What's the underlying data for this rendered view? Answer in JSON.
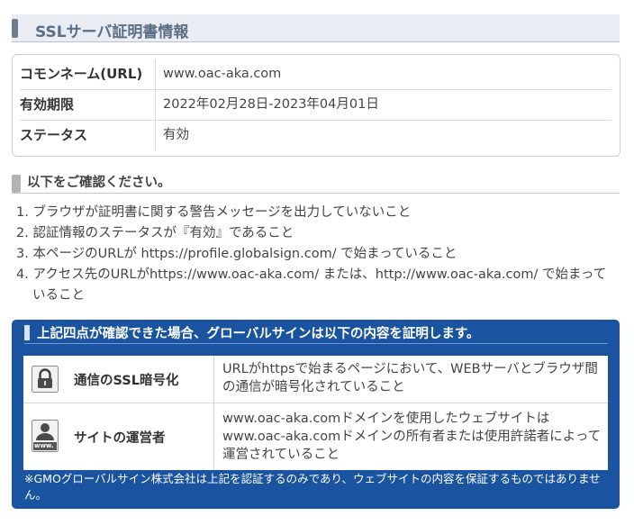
{
  "section_title": "SSLサーバ証明書情報",
  "cert_info": [
    {
      "label": "コモンネーム(URL)",
      "value": "www.oac-aka.com"
    },
    {
      "label": "有効期限",
      "value": "2022年02月28日-2023年04月01日"
    },
    {
      "label": "ステータス",
      "value": "有効"
    }
  ],
  "check_title": "以下をご確認ください。",
  "checks": [
    "1. ブラウザが証明書に関する警告メッセージを出力していないこと",
    "2. 認証情報のステータスが『有効』であること",
    "3. 本ページのURLが https://profile.globalsign.com/ で始まっていること",
    "4. アクセス先のURLがhttps://www.oac-aka.com/ または、http://www.oac-aka.com/ で始まっていること"
  ],
  "proof_panel": {
    "title": "上記四点が確認できた場合、グローバルサインは以下の内容を証明します。",
    "rows": [
      {
        "icon": "lock-icon",
        "label": "通信のSSL暗号化",
        "description": "URLがhttpsで始まるページにおいて、WEBサーバとブラウザ間の通信が暗号化されていること"
      },
      {
        "icon": "website-owner-icon",
        "icon_caption": "www.",
        "label": "サイトの運営者",
        "description": "www.oac-aka.comドメインを使用したウェブサイトはwww.oac-aka.comドメインの所有者または使用許諾者によって運営されていること"
      }
    ],
    "footnote": "※GMOグローバルサイン株式会社は上記を認証するのみであり、ウェブサイトの内容を保証するものではありません。"
  },
  "colors": {
    "panel_blue": "#1a54a1",
    "title_text": "#5b6e84"
  }
}
